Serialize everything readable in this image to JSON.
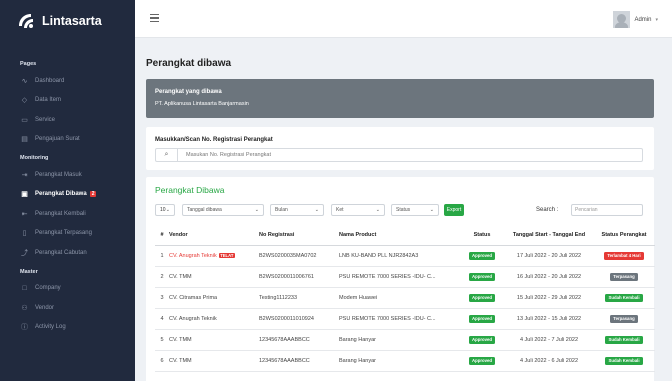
{
  "brand": {
    "name": "Lintasarta"
  },
  "sidebar": {
    "pages_label": "Pages",
    "pages": [
      {
        "label": "Dashboard",
        "icon": "activity-icon"
      },
      {
        "label": "Data Item",
        "icon": "box-icon"
      },
      {
        "label": "Service",
        "icon": "truck-icon"
      },
      {
        "label": "Pengajuan Surat",
        "icon": "file-icon"
      }
    ],
    "monitoring_label": "Monitoring",
    "monitoring": [
      {
        "label": "Perangkat Masuk",
        "icon": "log-in-icon"
      },
      {
        "label": "Perangkat Dibawa",
        "icon": "briefcase-icon",
        "badge": "2"
      },
      {
        "label": "Perangkat Kembali",
        "icon": "log-out-icon"
      },
      {
        "label": "Perangkat Terpasang",
        "icon": "tablet-icon"
      },
      {
        "label": "Perangkat Cabutan",
        "icon": "share-icon"
      }
    ],
    "master_label": "Master",
    "master": [
      {
        "label": "Company",
        "icon": "square-icon"
      },
      {
        "label": "Vendor",
        "icon": "users-icon"
      },
      {
        "label": "Activity Log",
        "icon": "info-icon"
      }
    ]
  },
  "topbar": {
    "user": "Admin"
  },
  "page_title": "Perangkat dibawa",
  "info": {
    "title": "Perangkat yang dibawa",
    "subtitle": "PT. Aplikanusa Lintasarta Banjarmasin"
  },
  "scan": {
    "label": "Masukkan/Scan No. Registrasi Perangkat",
    "placeholder": "Masukan No. Registrasi Perangkat"
  },
  "list": {
    "title": "Perangkat Dibawa",
    "page_size": "10",
    "filters": [
      "Tanggal dibawa",
      "Bulan",
      "Ket",
      "Status"
    ],
    "export": "Export",
    "search_label": "Search :",
    "search_placeholder": "Pencarian",
    "columns": [
      "#",
      "Vendor",
      "No Registrasi",
      "Nama Product",
      "Status",
      "Tanggal Start - Tanggal End",
      "Status Perangkat"
    ],
    "rows": [
      {
        "no": "1",
        "vendor": "CV. Anugrah Teknik",
        "tag": "TELAT",
        "reg": "B2WS0200035MA0702",
        "product": "LNB KU-BAND PLL NJR2842A3",
        "status": "Approved",
        "dates": "17 Juli 2022 - 20 Juli 2022",
        "state": "Terlambat 4 Hari",
        "kind": "late"
      },
      {
        "no": "2",
        "vendor": "CV. TMM",
        "tag": "",
        "reg": "B2WS0200011006761",
        "product": "PSU REMOTE 7000 SERIES -IDU- C...",
        "status": "Approved",
        "dates": "16 Juli 2022 - 20 Juli 2022",
        "state": "Terpasang",
        "kind": "gray"
      },
      {
        "no": "3",
        "vendor": "CV. Citramas Prima",
        "tag": "",
        "reg": "Testing1112233",
        "product": "Modem Huawei",
        "status": "Approved",
        "dates": "15 Juli 2022 - 29 Juli 2022",
        "state": "Sudah Kembali",
        "kind": "ok"
      },
      {
        "no": "4",
        "vendor": "CV. Anugrah Teknik",
        "tag": "",
        "reg": "B2WS0200011010924",
        "product": "PSU REMOTE 7000 SERIES -IDU- C...",
        "status": "Approved",
        "dates": "13 Juli 2022 - 15 Juli 2022",
        "state": "Terpasang",
        "kind": "gray"
      },
      {
        "no": "5",
        "vendor": "CV. TMM",
        "tag": "",
        "reg": "12345678AAABBCC",
        "product": "Barang Hanyar",
        "status": "Approved",
        "dates": "4 Juli 2022 - 7 Juli 2022",
        "state": "Sudah Kembali",
        "kind": "ok"
      },
      {
        "no": "6",
        "vendor": "CV. TMM",
        "tag": "",
        "reg": "12345678AAABBCC",
        "product": "Barang Hanyar",
        "status": "Approved",
        "dates": "4 Juli 2022 - 6 Juli 2022",
        "state": "Sudah Kembali",
        "kind": "ok"
      }
    ]
  }
}
